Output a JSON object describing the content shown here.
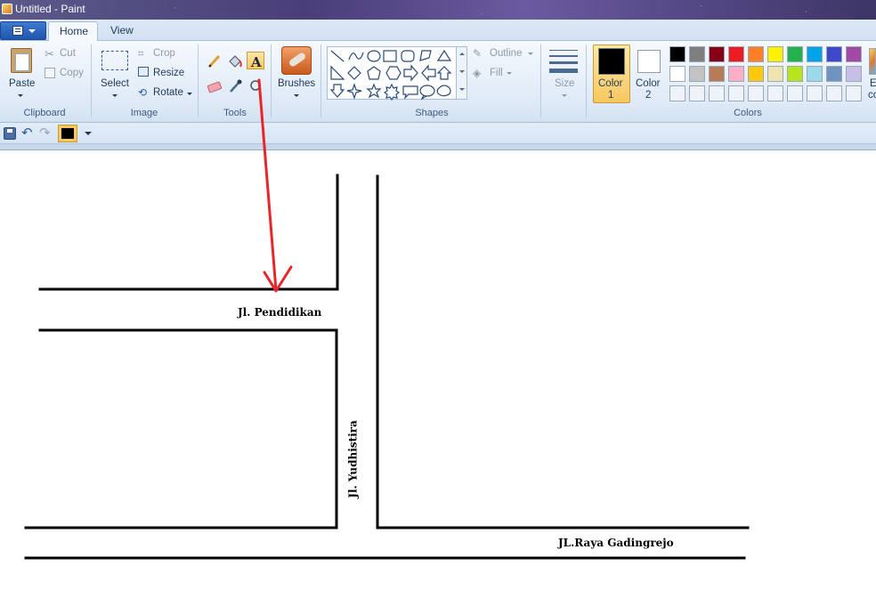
{
  "window": {
    "title": "Untitled - Paint"
  },
  "tabs": [
    {
      "label": "Home"
    },
    {
      "label": "View"
    }
  ],
  "clipboard": {
    "paste": "Paste",
    "cut": "Cut",
    "copy": "Copy",
    "group": "Clipboard"
  },
  "image": {
    "select": "Select",
    "crop": "Crop",
    "resize": "Resize",
    "rotate": "Rotate",
    "group": "Image"
  },
  "tools": {
    "group": "Tools",
    "active": "text-tool"
  },
  "brushes": {
    "label": "Brushes"
  },
  "shapes": {
    "outline": "Outline",
    "fill": "Fill",
    "group": "Shapes"
  },
  "size": {
    "label": "Size"
  },
  "colors": {
    "color1_line1": "Color",
    "color1_line2": "1",
    "color2_line1": "Color",
    "color2_line2": "2",
    "edit_partial_1": "E",
    "edit_partial_2": "co",
    "group": "Colors",
    "color1_value": "#000000",
    "color2_value": "#ffffff",
    "palette_row1": [
      "#000000",
      "#7f7f7f",
      "#880015",
      "#ed1c24",
      "#ff7f27",
      "#fff200",
      "#22b14c",
      "#00a2e8",
      "#3f48cc",
      "#a349a4"
    ],
    "palette_row2": [
      "#ffffff",
      "#c3c3c3",
      "#b97a57",
      "#ffaec9",
      "#ffc90e",
      "#efe4b0",
      "#b5e61d",
      "#99d9ea",
      "#7092be",
      "#c8bfe7"
    ]
  },
  "canvas": {
    "labels": {
      "pendidikan": "Jl. Pendidikan",
      "yudhistira": "Jl. Yudhistira",
      "gadingrejo": "JL.Raya Gadingrejo"
    },
    "arrow_color": "#e8262a"
  }
}
